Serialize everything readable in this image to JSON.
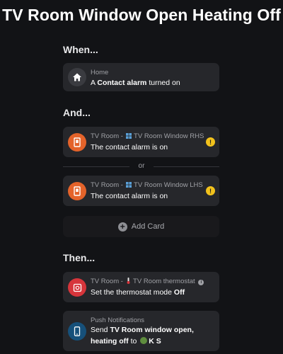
{
  "title": "TV Room Window Open Heating Off",
  "sections": {
    "when": "When...",
    "and": "And...",
    "then": "Then..."
  },
  "when_card": {
    "sub": "Home",
    "main_prefix": "A",
    "main_bold": "Contact alarm",
    "main_suffix": "turned on",
    "icon": "home-icon"
  },
  "and_cards": [
    {
      "sub_prefix": "TV Room -",
      "sub_device": "TV Room Window RHS",
      "main": "The contact alarm is on",
      "warning": "!",
      "icon": "contact-sensor-icon"
    },
    {
      "sub_prefix": "TV Room -",
      "sub_device": "TV Room Window LHS",
      "main": "The contact alarm is on",
      "warning": "!",
      "icon": "contact-sensor-icon"
    }
  ],
  "or_label": "or",
  "add_card_label": "Add Card",
  "then_cards": [
    {
      "sub_prefix": "TV Room -",
      "sub_device": "TV Room thermostat",
      "info": "i",
      "main_prefix": "Set the thermostat mode",
      "main_bold": "Off",
      "icon": "thermostat-icon"
    },
    {
      "sub": "Push Notifications",
      "main_line1_prefix": "Send",
      "main_line1_bold": "TV Room window open,",
      "main_line2_bold": "heating off",
      "main_line2_mid": "to",
      "main_line2_recipient": "K S",
      "icon": "phone-icon"
    }
  ],
  "colors": {
    "background": "#121316",
    "card": "#26272b",
    "home_icon_bg": "#3a3b40",
    "contact_icon_bg": "#e4632a",
    "thermostat_icon_bg": "#d6353b",
    "phone_icon_bg": "#16507a",
    "warning": "#f2c21c"
  }
}
